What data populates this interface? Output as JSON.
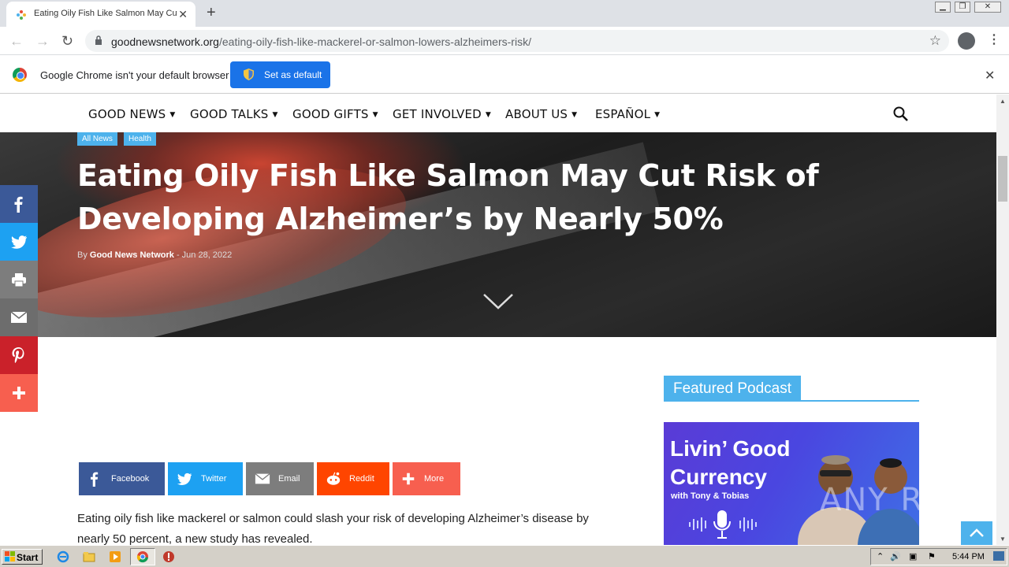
{
  "browser": {
    "tab_title": "Eating Oily Fish Like Salmon May Cut",
    "url_host": "goodnewsnetwork.org",
    "url_path": "/eating-oily-fish-like-mackerel-or-salmon-lowers-alzheimers-risk/",
    "infobar_text": "Google Chrome isn't your default browser",
    "set_default_label": "Set as default"
  },
  "site_nav": {
    "items": [
      {
        "label": "GOOD NEWS"
      },
      {
        "label": "GOOD TALKS"
      },
      {
        "label": "GOOD GIFTS"
      },
      {
        "label": "GET INVOLVED"
      },
      {
        "label": "ABOUT US"
      },
      {
        "label": "ESPAÑOL"
      }
    ]
  },
  "article": {
    "categories": [
      "All News",
      "Health"
    ],
    "title": "Eating Oily Fish Like Salmon May Cut Risk of Developing Alzheimer’s by Nearly 50%",
    "by": "By",
    "author": "Good News Network",
    "separator": "-",
    "date": "Jun 28, 2022",
    "body": "Eating oily fish like mackerel or salmon could slash your risk of developing Alzheimer’s disease by nearly 50 percent, a new study has revealed."
  },
  "share_buttons": [
    {
      "label": "Facebook",
      "color": "#3b5998"
    },
    {
      "label": "Twitter",
      "color": "#1da1f2"
    },
    {
      "label": "Email",
      "color": "#7d7d7d"
    },
    {
      "label": "Reddit",
      "color": "#ff4500"
    },
    {
      "label": "More",
      "color": "#f75f4f"
    }
  ],
  "side_social": [
    {
      "icon": "facebook-icon",
      "color": "#3b5998"
    },
    {
      "icon": "twitter-icon",
      "color": "#1da1f2"
    },
    {
      "icon": "print-icon",
      "color": "#7d7d7d"
    },
    {
      "icon": "email-icon",
      "color": "#6d6d6d"
    },
    {
      "icon": "pinterest-icon",
      "color": "#ca212a"
    },
    {
      "icon": "plus-icon",
      "color": "#f75f4f"
    }
  ],
  "sidebar": {
    "featured_title": "Featured Podcast",
    "podcast_line1": "Livin’ Good",
    "podcast_line2": "Currency",
    "podcast_line3": "with Tony & Tobias"
  },
  "watermark": "ANY RUN",
  "taskbar": {
    "start_label": "Start",
    "clock": "5:44 PM"
  },
  "colors": {
    "accent": "#4db2ec",
    "chrome_blue": "#1a73e8"
  }
}
